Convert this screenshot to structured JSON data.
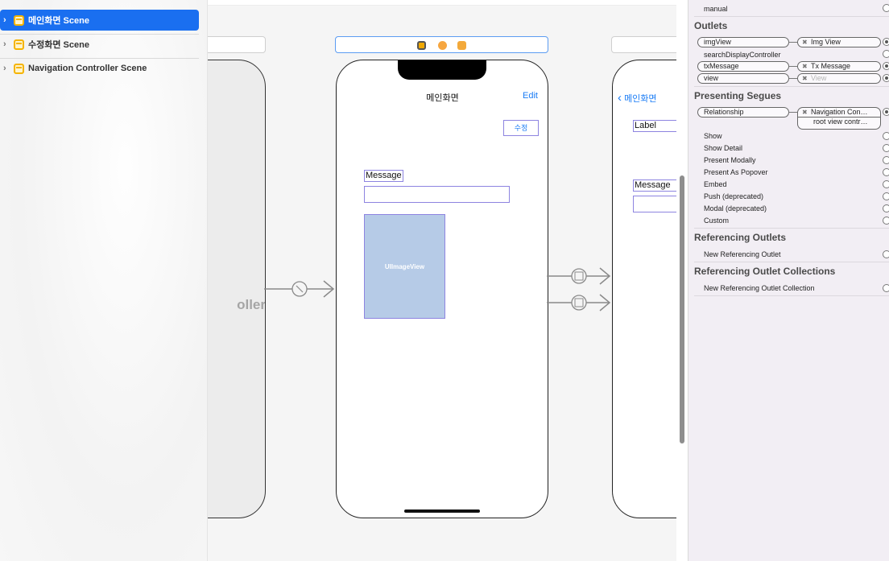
{
  "outline": {
    "scenes": [
      {
        "label": "메인화면 Scene",
        "selected": true
      },
      {
        "label": "수정화면 Scene",
        "selected": false
      },
      {
        "label": "Navigation Controller Scene",
        "selected": false
      }
    ]
  },
  "canvas": {
    "left_scene": {
      "title_fragment": "oller"
    },
    "main_scene": {
      "nav_title": "메인화면",
      "edit_button": "Edit",
      "modify_button": "수정",
      "message_label": "Message",
      "image_view_label": "UIImageView"
    },
    "right_scene": {
      "back_label": "메인화면",
      "label": "Label",
      "message_label": "Message"
    }
  },
  "inspector": {
    "top_item": "manual",
    "outlets": {
      "header": "Outlets",
      "items": [
        {
          "name": "imgView",
          "target": "Img View",
          "connected": true
        },
        {
          "name": "searchDisplayController",
          "target": "",
          "connected": false
        },
        {
          "name": "txMessage",
          "target": "Tx Message",
          "connected": true
        },
        {
          "name": "view",
          "target": "View",
          "connected": true
        }
      ]
    },
    "presenting_segues": {
      "header": "Presenting Segues",
      "relationship": {
        "name": "Relationship",
        "target": "Navigation Con…",
        "sub": "root view contr…"
      },
      "items": [
        "Show",
        "Show Detail",
        "Present Modally",
        "Present As Popover",
        "Embed",
        "Push (deprecated)",
        "Modal (deprecated)",
        "Custom"
      ]
    },
    "referencing_outlets": {
      "header": "Referencing Outlets",
      "item": "New Referencing Outlet"
    },
    "referencing_collections": {
      "header": "Referencing Outlet Collections",
      "item": "New Referencing Outlet Collection"
    }
  },
  "colors": {
    "accent": "#1a6ff0",
    "link": "#1a7cf5",
    "constraint": "#8d84e0",
    "scene_icon": "#f5b400"
  }
}
